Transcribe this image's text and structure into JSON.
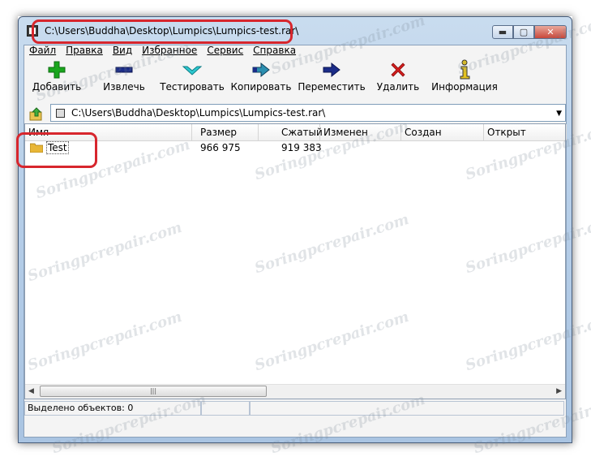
{
  "window": {
    "title": "C:\\Users\\Buddha\\Desktop\\Lumpics\\Lumpics-test.rar\\",
    "controls": {
      "minimize": "▬",
      "maximize": "▢",
      "close": "✕"
    }
  },
  "menu": [
    "Файл",
    "Правка",
    "Вид",
    "Избранное",
    "Сервис",
    "Справка"
  ],
  "toolbar": [
    {
      "label": "Добавить",
      "icon": "add-icon"
    },
    {
      "label": "Извлечь",
      "icon": "extract-icon"
    },
    {
      "label": "Тестировать",
      "icon": "test-icon"
    },
    {
      "label": "Копировать",
      "icon": "copy-icon"
    },
    {
      "label": "Переместить",
      "icon": "move-icon"
    },
    {
      "label": "Удалить",
      "icon": "delete-icon"
    },
    {
      "label": "Информация",
      "icon": "info-icon"
    }
  ],
  "address": {
    "path": "C:\\Users\\Buddha\\Desktop\\Lumpics\\Lumpics-test.rar\\"
  },
  "columns": [
    "Имя",
    "Размер",
    "Сжатый",
    "Изменен",
    "Создан",
    "Открыт"
  ],
  "rows": [
    {
      "name": "Test",
      "size": "966 975",
      "packed": "919 383",
      "modified": "",
      "created": "",
      "accessed": ""
    }
  ],
  "status": {
    "selected": "Выделено объектов: 0"
  },
  "watermark": "Soringpcrepair.com",
  "colors": {
    "highlight": "#d7262d",
    "add": "#19a61d",
    "extract": "#1b2c88",
    "test": "#2cc7cf",
    "delete": "#d21d1d"
  }
}
